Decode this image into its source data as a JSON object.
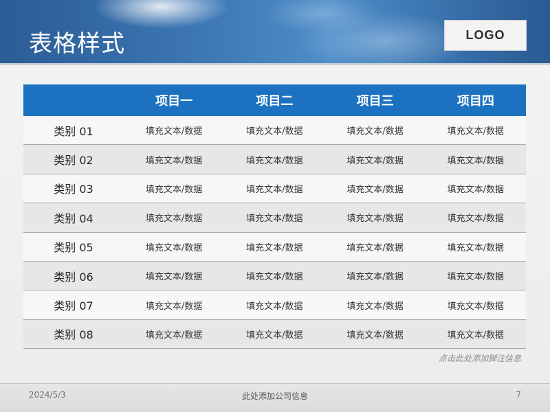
{
  "slide": {
    "title": "表格样式",
    "logo": "LOGO",
    "footnote": "点击此处添加脚注信息"
  },
  "table": {
    "headers": [
      "",
      "项目一",
      "项目二",
      "项目三",
      "项目四"
    ],
    "rows": [
      {
        "category": "类别 01",
        "cells": [
          "填充文本/数据",
          "填充文本/数据",
          "填充文本/数据",
          "填充文本/数据"
        ]
      },
      {
        "category": "类别 02",
        "cells": [
          "填充文本/数据",
          "填充文本/数据",
          "填充文本/数据",
          "填充文本/数据"
        ]
      },
      {
        "category": "类别 03",
        "cells": [
          "填充文本/数据",
          "填充文本/数据",
          "填充文本/数据",
          "填充文本/数据"
        ]
      },
      {
        "category": "类别 04",
        "cells": [
          "填充文本/数据",
          "填充文本/数据",
          "填充文本/数据",
          "填充文本/数据"
        ]
      },
      {
        "category": "类别 05",
        "cells": [
          "填充文本/数据",
          "填充文本/数据",
          "填充文本/数据",
          "填充文本/数据"
        ]
      },
      {
        "category": "类别 06",
        "cells": [
          "填充文本/数据",
          "填充文本/数据",
          "填充文本/数据",
          "填充文本/数据"
        ]
      },
      {
        "category": "类别 07",
        "cells": [
          "填充文本/数据",
          "填充文本/数据",
          "填充文本/数据",
          "填充文本/数据"
        ]
      },
      {
        "category": "类别 08",
        "cells": [
          "填充文本/数据",
          "填充文本/数据",
          "填充文本/数据",
          "填充文本/数据"
        ]
      }
    ]
  },
  "footer": {
    "date": "2024/5/3",
    "company": "此处添加公司信息",
    "page": "7"
  },
  "colors": {
    "header_bar": "#1c72c0",
    "banner": "#3c76b3"
  }
}
